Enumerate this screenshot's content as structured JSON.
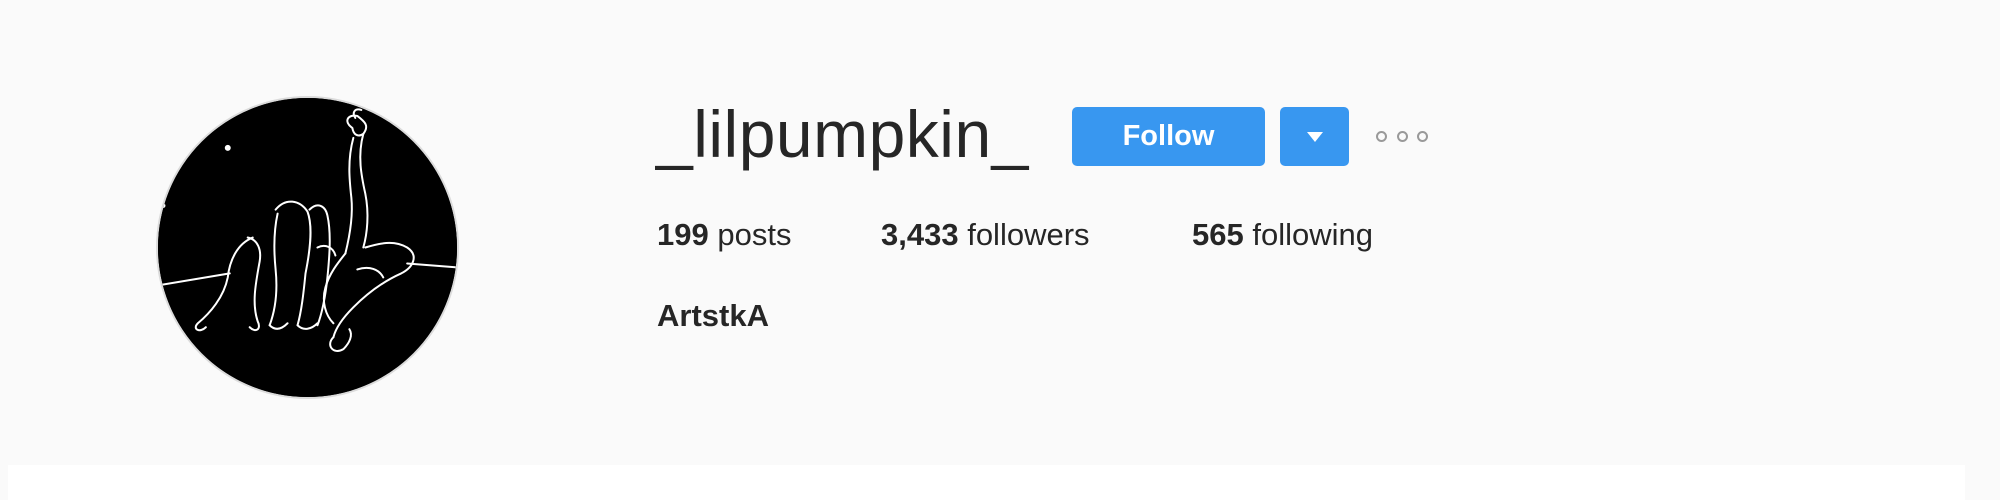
{
  "profile": {
    "username": "_lilpumpkin_",
    "full_name": "ArtstkA",
    "avatar_icon": "line-art-avatar"
  },
  "actions": {
    "follow_label": "Follow",
    "dropdown_icon": "caret-down-icon",
    "more_icon": "ellipsis-icon"
  },
  "stats": {
    "posts": {
      "count": "199",
      "label": "posts"
    },
    "followers": {
      "count": "3,433",
      "label": "followers"
    },
    "following": {
      "count": "565",
      "label": "following"
    }
  },
  "colors": {
    "background": "#fafafa",
    "button": "#3897f0",
    "text": "#262626"
  }
}
